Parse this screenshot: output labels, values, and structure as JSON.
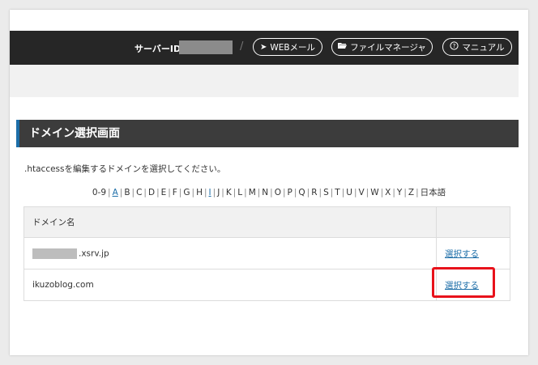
{
  "topbar": {
    "server_id_label": "サーバーID",
    "separator": "/",
    "buttons": [
      {
        "label": "WEBメール",
        "icon": "paper-plane-icon"
      },
      {
        "label": "ファイルマネージャ",
        "icon": "folder-open-icon"
      },
      {
        "label": "マニュアル",
        "icon": "question-circle-icon"
      }
    ]
  },
  "section": {
    "title": "ドメイン選択画面"
  },
  "description": ".htaccessを編集するドメインを選択してください。",
  "alphabet_filter": {
    "items": [
      "0-9",
      "A",
      "B",
      "C",
      "D",
      "E",
      "F",
      "G",
      "H",
      "I",
      "J",
      "K",
      "L",
      "M",
      "N",
      "O",
      "P",
      "Q",
      "R",
      "S",
      "T",
      "U",
      "V",
      "W",
      "X",
      "Y",
      "Z",
      "日本語"
    ],
    "linked": [
      "A",
      "I"
    ]
  },
  "domain_table": {
    "header": "ドメイン名",
    "rows": [
      {
        "domain": ".xsrv.jp",
        "action": "選択する"
      },
      {
        "domain": "ikuzoblog.com",
        "action": "選択する"
      }
    ]
  },
  "colors": {
    "topbar_bg": "#262626",
    "accent_blue": "#1d6ea8",
    "highlight_red": "#e8121b"
  }
}
